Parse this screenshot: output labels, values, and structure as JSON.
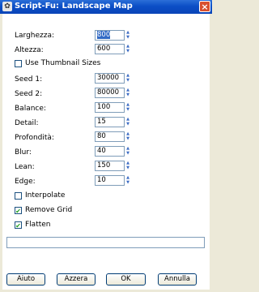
{
  "window": {
    "title": "Script-Fu: Landscape Map",
    "close_label": "×"
  },
  "fields": [
    {
      "label": "Larghezza:",
      "value": "800"
    },
    {
      "label": "Altezza:",
      "value": "600"
    },
    {
      "label": "Seed 1:",
      "value": "30000"
    },
    {
      "label": "Seed 2:",
      "value": "80000"
    },
    {
      "label": "Balance:",
      "value": "100"
    },
    {
      "label": "Detail:",
      "value": "15"
    },
    {
      "label": "Profondità:",
      "value": "80"
    },
    {
      "label": "Blur:",
      "value": "40"
    },
    {
      "label": "Lean:",
      "value": "150"
    },
    {
      "label": "Edge:",
      "value": "10"
    }
  ],
  "checkboxes": [
    {
      "label": "Use Thumbnail Sizes",
      "checked": false
    },
    {
      "label": "Interpolate",
      "checked": false
    },
    {
      "label": "Remove Grid",
      "checked": true
    },
    {
      "label": "Flatten",
      "checked": true
    }
  ],
  "text_input": {
    "value": ""
  },
  "buttons": {
    "help": "Aiuto",
    "reset": "Azzera",
    "ok": "OK",
    "cancel": "Annulla"
  },
  "icons": {
    "app": "gimp-script-fu-icon",
    "close": "close-icon",
    "spin": "spin-arrows-icon",
    "check": "checkmark-icon"
  }
}
